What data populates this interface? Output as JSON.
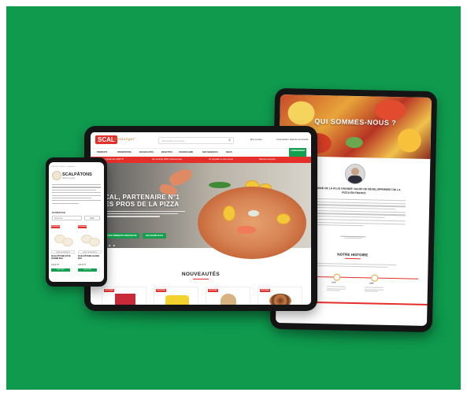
{
  "colors": {
    "background_green": "#0f9a4e",
    "brand_red": "#e42f2a",
    "brand_green": "#12a04e",
    "device_frame": "#151515"
  },
  "right_tablet": {
    "hero_title": "QUI SOMMES-NOUS ?",
    "lead_text": "À L'ORIGINE DE LA PLUS GRANDE VAGUE DE DÉVELOPPEMENT DE LA PIZZA EN FRANCE",
    "section_title": "NOTRE HISTOIRE",
    "timeline_labels": [
      "1978",
      "1985",
      "1992"
    ]
  },
  "center_tablet": {
    "logo": "SCAL",
    "logo_script": "Boulanger",
    "search_placeholder": "Rechercher un produit...",
    "utility_links": [
      "Mon compte",
      "Commander / Suivi de commande"
    ],
    "nav_items": [
      "PRODUITS",
      "PROMOTIONS",
      "NOUVEAUTÉS",
      "RECETTES",
      "SAVOIR-FAIRE",
      "NOS MARQUES",
      "NOUS"
    ],
    "cta_label": "COMMANDER",
    "promo_bar": [
      "Livraison gratuite dès 200€ HT",
      "Des produits 100% professionnels",
      "Un conseiller à votre écoute",
      "Paiement sécurisé"
    ],
    "hero_title_line1": "SCAL, PARTENAIRE N°1",
    "hero_title_line2": "DES PROS DE LA PIZZA",
    "hero_buttons": [
      "VOIR NOS PRODUITS PIZZAIOLOS",
      "EN SAVOIR PLUS"
    ],
    "carousel_dots": "● ● ● ●",
    "section_title": "NOUVEAUTÉS",
    "card_badge": "NOUVEAU"
  },
  "phone": {
    "breadcrumb": "Accueil / Produits / Scalpâtons",
    "brand_title": "SCALPÂTONS",
    "brand_sub": "Pâtons surgelés",
    "filter_label": "FILTRER PAR",
    "select_value": "Pertinence",
    "select_button": "Filtrer",
    "products": [
      {
        "badge": "NOUVEAU",
        "button": "VOIR LE PRODUIT",
        "name": "SCALPÂTONS PÂTE FARINE BLÉ",
        "price": "0,00 € HT",
        "add": "AJOUTER"
      },
      {
        "badge": "NOUVEAU",
        "button": "VOIR LE PRODUIT",
        "name": "SCALPÂTONS LEVAIN BLÉ",
        "price": "0,00 € HT",
        "add": "AJOUTER"
      }
    ]
  }
}
